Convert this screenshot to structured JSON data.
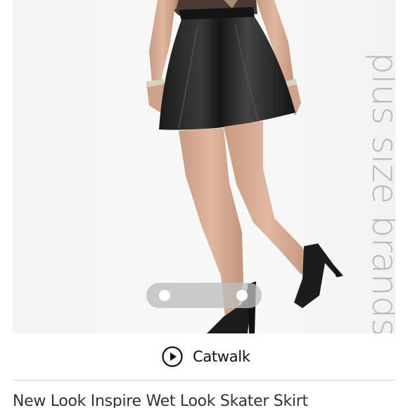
{
  "product": {
    "image_alt": "Black wet look skater skirt with black mesh heels",
    "brand_tag": "plus size brands",
    "title": "New Look Inspire Wet Look Skater Skirt"
  },
  "carousel": {
    "dot_count": 2,
    "active_index": 0
  },
  "catwalk": {
    "label": "Catwalk",
    "icon": "play-circle-icon"
  },
  "colors": {
    "image_background": "#f6f6f6",
    "brand_tag": "#b9b9b9",
    "pager_background": "#bebebe",
    "divider": "#d4d4d4"
  }
}
